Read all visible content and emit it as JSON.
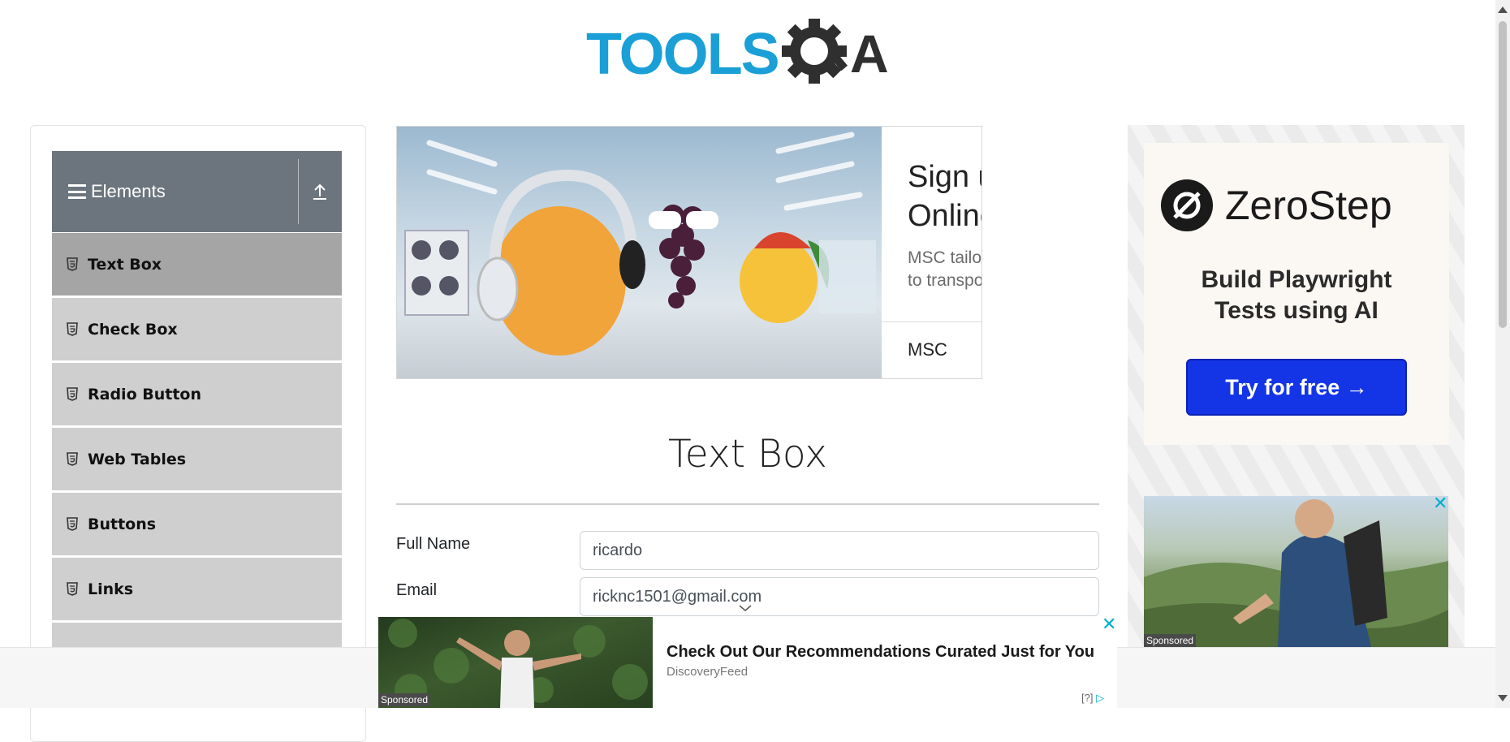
{
  "logo": {
    "text_tools": "TOOLS",
    "text_qa": "QA",
    "brand_color": "#1a9fd6"
  },
  "sidebar": {
    "group_title": "Elements",
    "items": [
      {
        "label": "Text Box",
        "active": true
      },
      {
        "label": "Check Box"
      },
      {
        "label": "Radio Button"
      },
      {
        "label": "Web Tables"
      },
      {
        "label": "Buttons"
      },
      {
        "label": "Links"
      }
    ]
  },
  "ad_top": {
    "headline": "Sign up on my\nOnline",
    "body": "MSC tailors for you comple\nto transport your Mangos",
    "brand": "MSC"
  },
  "ad_right": {
    "brand": "ZeroStep",
    "tagline": "Build Playwright\nTests using AI",
    "button": "Try for free →",
    "sponsored": "Sponsored",
    "close": "✕"
  },
  "main": {
    "title": "Text Box",
    "full_name_label": "Full Name",
    "full_name_value": "ricardo",
    "email_label": "Email",
    "email_value": "ricknc1501@gmail.com"
  },
  "bottom_ad": {
    "headline": "Check Out Our Recommendations Curated Just for You",
    "source": "DiscoveryFeed",
    "sponsored": "Sponsored",
    "close": "✕",
    "info": "[?]"
  }
}
